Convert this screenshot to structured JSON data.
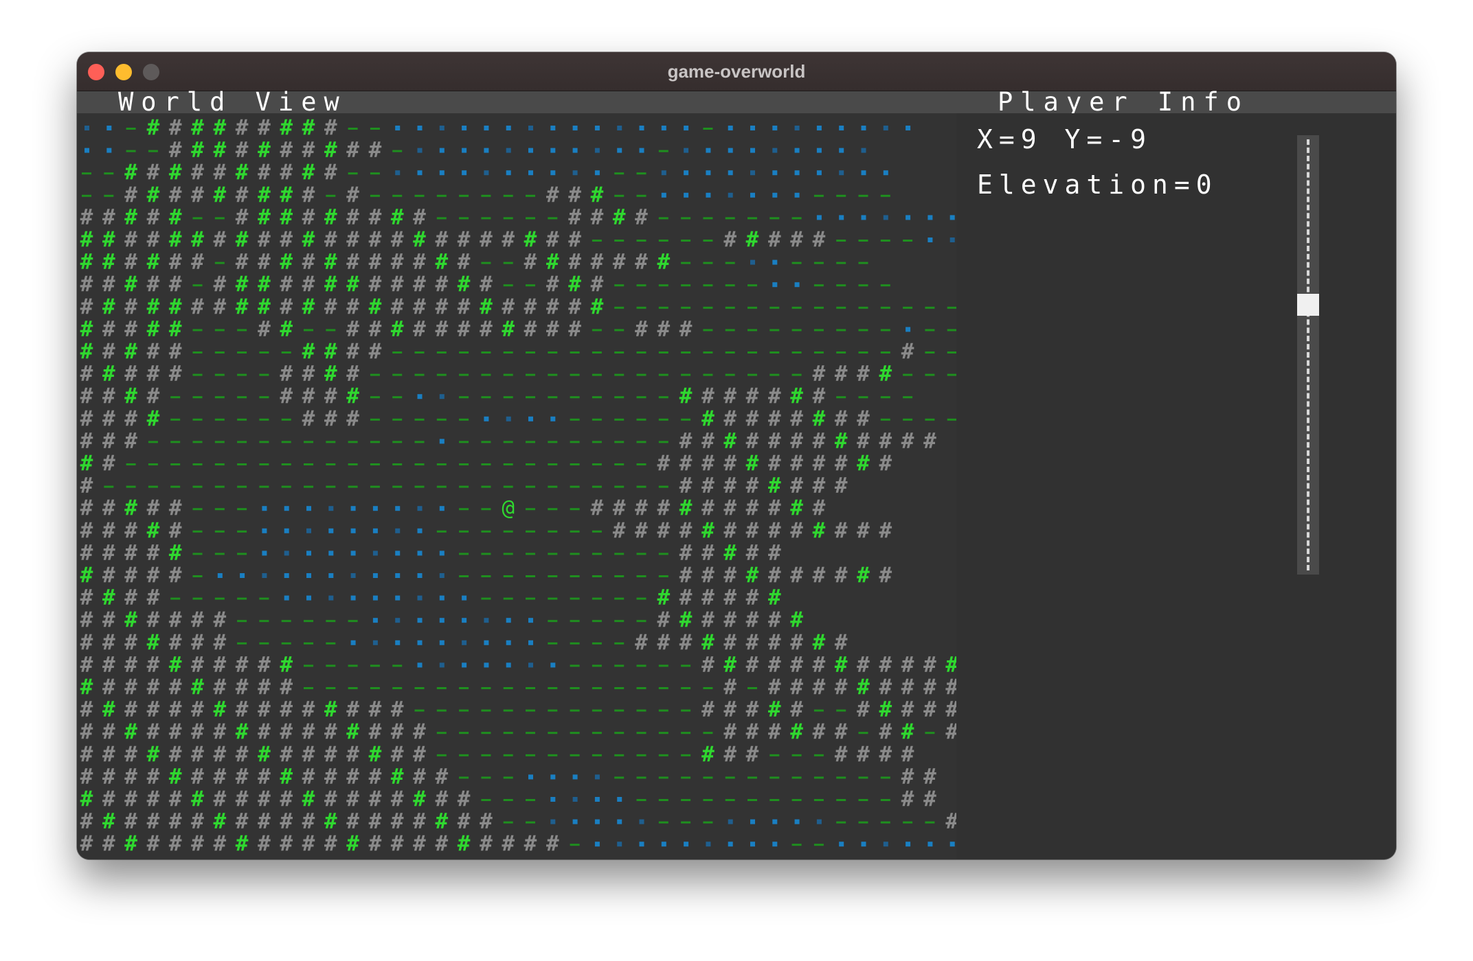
{
  "window": {
    "title": "game-overworld"
  },
  "header": {
    "world_label": "World View",
    "player_label": "Player Info"
  },
  "player_info": {
    "position": "X=9 Y=-9",
    "elevation": "Elevation=0"
  },
  "colors": {
    "mountain": "#8a8a8a",
    "forest": "#2fd82f",
    "grass": "#1f8f1f",
    "water": "#1a7fc2",
    "deep_water": "#1f5f8f",
    "player": "#2fd82f"
  },
  "legend": {
    "mountain": "#",
    "forest": "#",
    "grass": "-",
    "water": ".",
    "player": "@"
  },
  "map": {
    "player_glyph": "@",
    "rows": [
      "..-#########--..............-.........",
      "..--##########-...........-.........",
      "--##########--..........--...........",
      "--#########-#--------###--.......----",
      "#####--#########------####-------.......",
      "#######################------#####----..-----",
      "######-###########--#######---..----",
      "#####-#############--###-------..----",
      "########################-----------------",
      "#####---##--###########--###---------.----",
      "#####-----####-----------------------#-----",
      "#####----####--------------------####------",
      "####-----####--..----------#######----",
      "####------###-----....------########----##",
      "###-------------.----------############",
      "##------------------------###########",
      "#--------------------------########",
      "#####---.........--@---###########",
      "#####---........--------#############",
      "#####---.........----------#####",
      "#####-...........----------##########",
      "####-----.........--------######",
      "#######------........-----#######",
      "#######-----.........----##########",
      "##########-----.......------#############",
      "##########-------------------#-##########",
      "###############-------------#####--########",
      "################-------------######-##-#####",
      "################------------###---####",
      "#################---....-------------##",
      "##################---....------------##",
      "###################--.....---.....-----##",
      "######################-.........--.........---"
    ]
  }
}
